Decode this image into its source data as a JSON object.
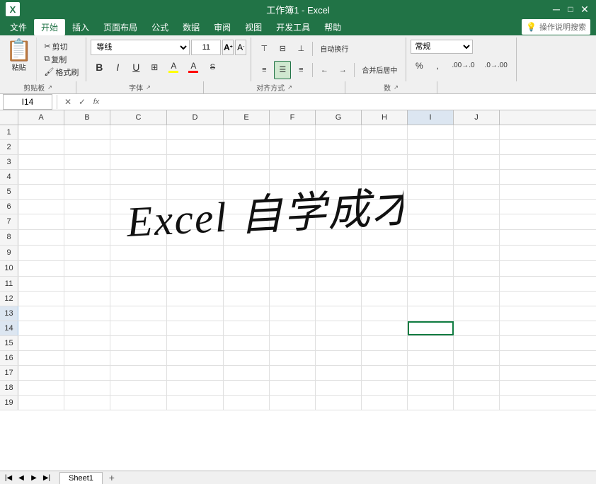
{
  "titlebar": {
    "filename": "工作簿1 - Excel",
    "icon": "X"
  },
  "menubar": {
    "items": [
      "文件",
      "开始",
      "插入",
      "页面布局",
      "公式",
      "数据",
      "审阅",
      "视图",
      "开发工具",
      "帮助"
    ],
    "active": "开始",
    "search_placeholder": "操作说明搜索"
  },
  "ribbon": {
    "clipboard": {
      "label": "剪贴板",
      "paste_label": "粘贴",
      "cut_label": "剪切",
      "copy_label": "复制",
      "format_label": "格式刷"
    },
    "font": {
      "label": "字体",
      "font_name": "等线",
      "font_size": "11",
      "bold": "B",
      "italic": "I",
      "underline": "U",
      "border_btn": "⊞",
      "fill_btn": "A",
      "color_btn": "A",
      "size_up": "A",
      "size_down": "A"
    },
    "alignment": {
      "label": "对齐方式",
      "auto_wrap_label": "自动换行",
      "merge_label": "合并后居中"
    },
    "number": {
      "label": "数",
      "format": "常规"
    }
  },
  "formulabar": {
    "cell_ref": "I14",
    "formula_value": ""
  },
  "grid": {
    "columns": [
      "A",
      "B",
      "C",
      "D",
      "E",
      "F",
      "G",
      "H",
      "I",
      "J"
    ],
    "rows": 19,
    "active_cell": "I14",
    "handwriting_text": "Excel 自学成才",
    "handwriting_row_start": 7,
    "handwriting_col_start": 2
  },
  "statusbar": {
    "sheet_tab": "Sheet1"
  },
  "icons": {
    "paste": "📋",
    "cut": "✂",
    "copy": "⧉",
    "format_painter": "🖌",
    "bold": "B",
    "italic": "I",
    "underline": "U",
    "increase_font": "A↑",
    "decrease_font": "A↓",
    "border": "⊞",
    "fill_color": "🎨",
    "font_color": "A",
    "align_left": "≡",
    "align_center": "≡",
    "align_right": "≡",
    "align_top": "⊤",
    "align_middle": "⊞",
    "align_bottom": "⊥",
    "indent_dec": "←",
    "indent_inc": "→",
    "wrap_text": "↵",
    "merge_center": "⊞",
    "number_format": "常规",
    "percent": "%",
    "comma": ",",
    "increase_decimal": ".0",
    "decrease_decimal": "0.",
    "search": "🔍",
    "lightbulb": "💡",
    "cancel": "✕",
    "confirm": "✓",
    "function": "fx",
    "chevron_down": "▼",
    "expand": "↗"
  }
}
